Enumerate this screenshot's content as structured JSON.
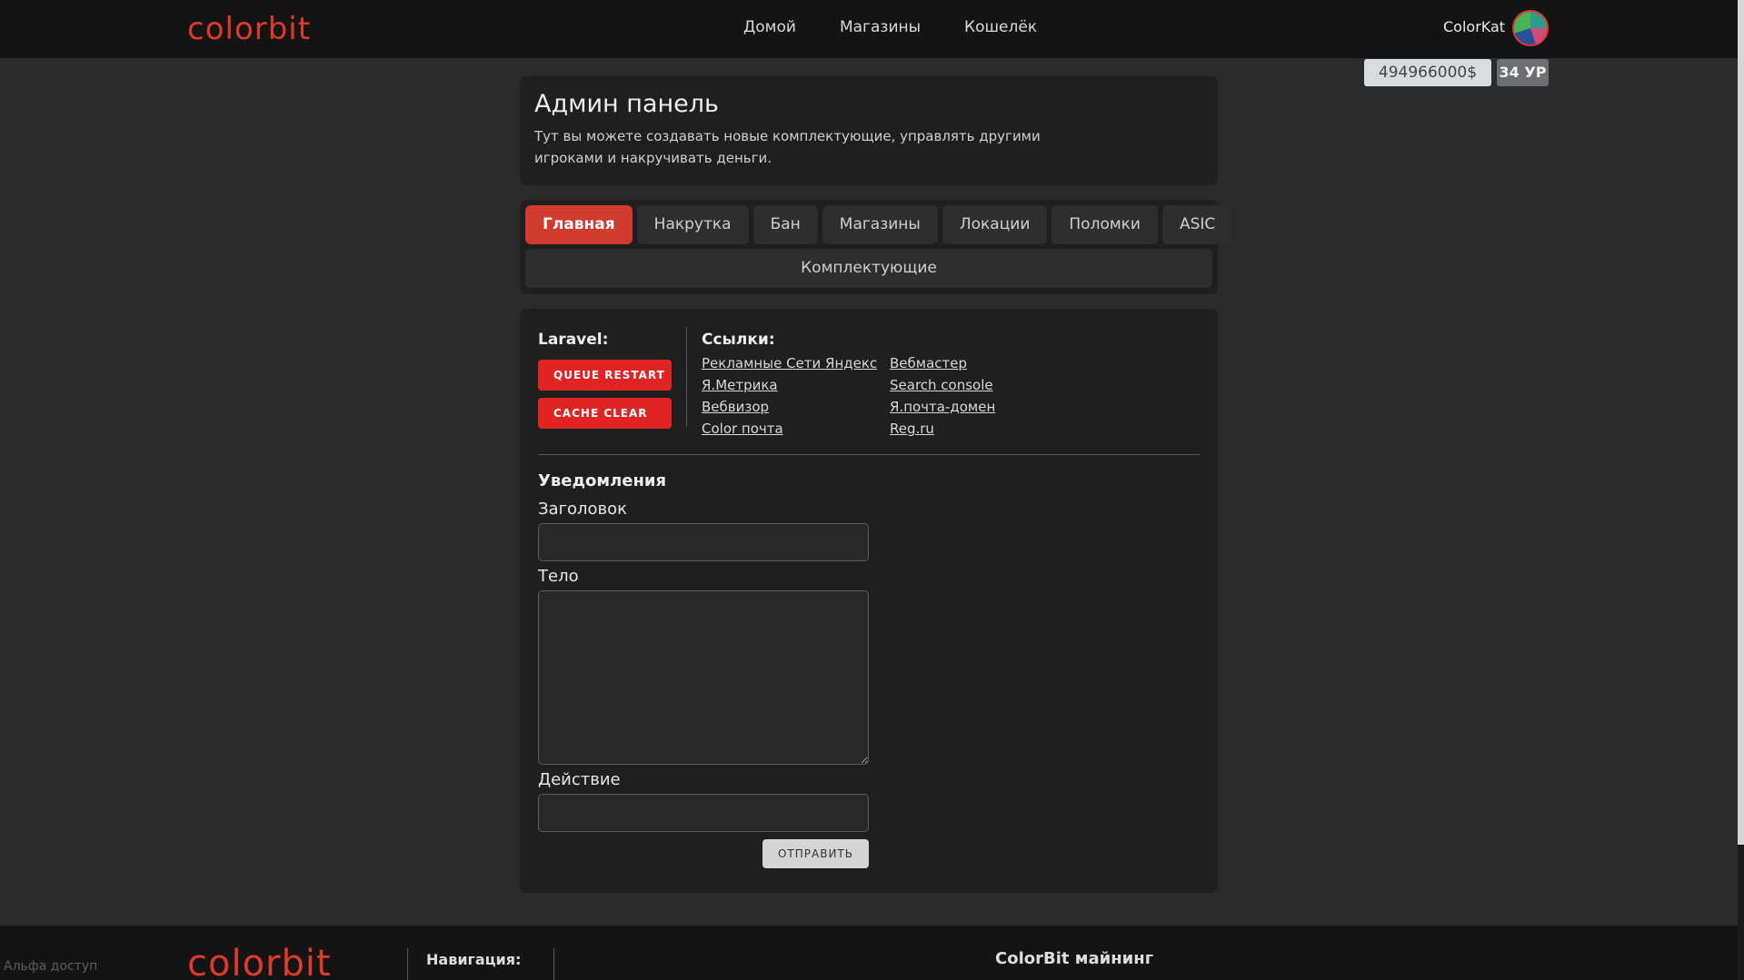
{
  "header": {
    "logo": "colorbit",
    "nav": [
      "Домой",
      "Магазины",
      "Кошелёк"
    ],
    "user_name": "ColorKat",
    "balance": "494966000$",
    "level": "34 УР"
  },
  "intro": {
    "title": "Админ панель",
    "description": "Тут вы можете создавать новые комплектующие, управлять другими игроками и накручивать деньги."
  },
  "tabs": {
    "row1": [
      "Главная",
      "Накрутка",
      "Бан",
      "Магазины",
      "Локации",
      "Поломки",
      "ASIC"
    ],
    "row2": "Комплектующие",
    "active": "Главная"
  },
  "laravel": {
    "label": "Laravel:",
    "queue_restart": "QUEUE RESTART",
    "cache_clear": "CACHE CLEAR"
  },
  "links": {
    "label": "Ссылки:",
    "items": [
      "Рекламные Сети Яндекс",
      "Вебмастер",
      "Я.Метрика",
      "Search console",
      "Вебвизор",
      "Я.почта-домен",
      "Color почта",
      "Reg.ru"
    ]
  },
  "notifications": {
    "title": "Уведомления",
    "heading_label": "Заголовок",
    "heading_value": "",
    "body_label": "Тело",
    "body_value": "",
    "action_label": "Действие",
    "action_value": "",
    "submit": "ОТПРАВИТЬ"
  },
  "footer": {
    "alpha": "Альфа доступ",
    "logo": "colorbit",
    "nav_label": "Навигация:",
    "brand": "ColorBit майнинг"
  },
  "colors": {
    "accent": "#e0392b",
    "active_tab": "#cf3b2d",
    "danger_button": "#e02424",
    "card_bg": "#1f1f1f",
    "page_bg": "#2b2b2b",
    "header_bg": "#141414"
  }
}
